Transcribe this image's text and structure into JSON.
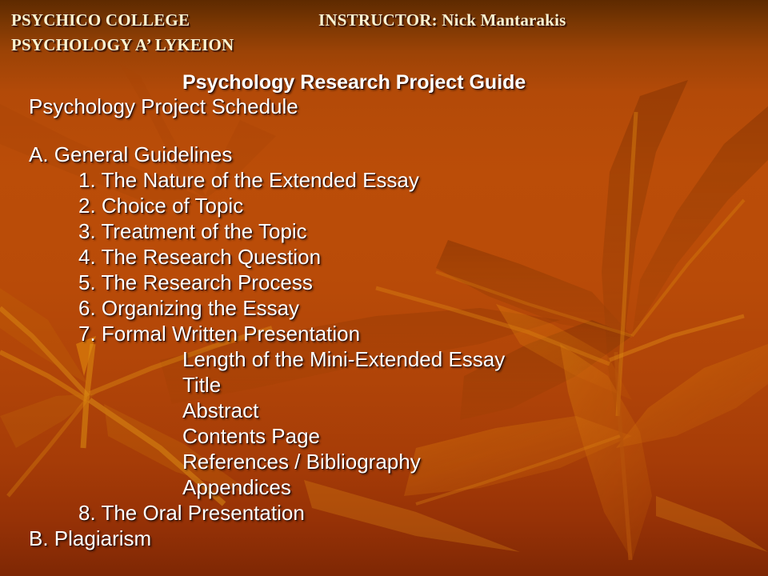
{
  "slide": {
    "background": {
      "top_color": "#5e2a00",
      "mid_color": "#bb4d08",
      "bottom_color": "#7e2704",
      "accent_color": "#e08a13",
      "motif": "maple-leaf"
    },
    "header": {
      "college": "PSYCHICO COLLEGE",
      "instructor": "INSTRUCTOR: Nick Mantarakis",
      "department": "PSYCHOLOGY A’ LYKEION",
      "text_color": "#fbf3d2"
    },
    "title": "Psychology Research Project Guide",
    "subtitle": "Psychology Project Schedule",
    "outline": [
      {
        "text": "A. General Guidelines",
        "indent": 0,
        "bold": false
      },
      {
        "text": "1. The Nature of the Extended Essay",
        "indent": 1,
        "bold": false
      },
      {
        "text": "2. Choice of Topic",
        "indent": 1,
        "bold": false
      },
      {
        "text": "3. Treatment of the Topic",
        "indent": 1,
        "bold": false
      },
      {
        "text": "4. The Research Question",
        "indent": 1,
        "bold": false
      },
      {
        "text": "5. The Research Process",
        "indent": 1,
        "bold": false
      },
      {
        "text": "6. Organizing the Essay",
        "indent": 1,
        "bold": false
      },
      {
        "text": "7. Formal Written Presentation",
        "indent": 1,
        "bold": false
      },
      {
        "text": "Length of the Mini-Extended Essay",
        "indent": 2,
        "bold": false
      },
      {
        "text": "Title",
        "indent": 2,
        "bold": false
      },
      {
        "text": "Abstract",
        "indent": 2,
        "bold": false
      },
      {
        "text": "Contents Page",
        "indent": 2,
        "bold": false
      },
      {
        "text": "References / Bibliography",
        "indent": 2,
        "bold": false
      },
      {
        "text": "Appendices",
        "indent": 2,
        "bold": false
      },
      {
        "text": "8. The Oral Presentation",
        "indent": 1,
        "bold": false
      },
      {
        "text": "B. Plagiarism",
        "indent": 0,
        "bold": false
      }
    ]
  }
}
